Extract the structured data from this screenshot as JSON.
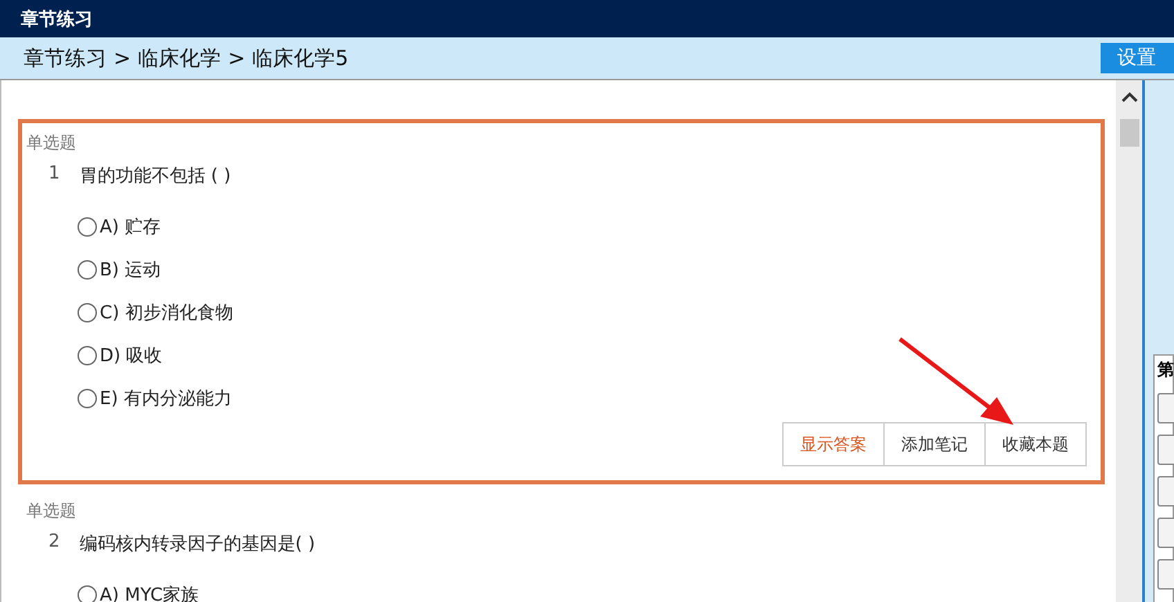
{
  "window": {
    "title": "章节练习"
  },
  "breadcrumb": [
    "章节练习",
    ">",
    "临床化学",
    ">",
    "临床化学5"
  ],
  "settings_button": "设置",
  "questions": [
    {
      "type": "单选题",
      "number": "1",
      "text": "胃的功能不包括 ( )",
      "highlighted": true,
      "options": [
        {
          "label": "A) 贮存",
          "selected": false
        },
        {
          "label": "B) 运动",
          "selected": false
        },
        {
          "label": "C) 初步消化食物",
          "selected": false
        },
        {
          "label": "D) 吸收",
          "selected": false
        },
        {
          "label": "E) 有内分泌能力",
          "selected": false
        }
      ],
      "actions": [
        {
          "label": "显示答案",
          "kind": "accent"
        },
        {
          "label": "添加笔记",
          "kind": "plain"
        },
        {
          "label": "收藏本题",
          "kind": "plain"
        }
      ]
    },
    {
      "type": "单选题",
      "number": "2",
      "text": "编码核内转录因子的基因是( )",
      "highlighted": false,
      "options": [
        {
          "label": "A) MYC家族",
          "selected": false
        }
      ]
    }
  ],
  "side_panel": {
    "card_title": "第"
  }
}
